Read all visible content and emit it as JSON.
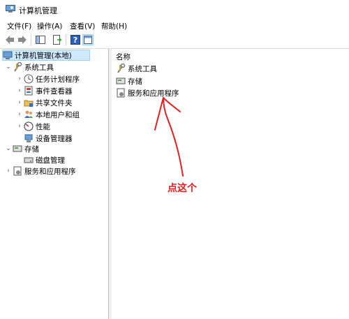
{
  "window": {
    "title": "计算机管理"
  },
  "menu": {
    "file": "文件(F)",
    "action": "操作(A)",
    "view": "查看(V)",
    "help": "帮助(H)"
  },
  "tree": {
    "root": "计算机管理(本地)",
    "system_tools": "系统工具",
    "task_scheduler": "任务计划程序",
    "event_viewer": "事件查看器",
    "shared_folders": "共享文件夹",
    "local_users": "本地用户和组",
    "performance": "性能",
    "device_manager": "设备管理器",
    "storage": "存储",
    "disk_management": "磁盘管理",
    "services_apps": "服务和应用程序"
  },
  "list": {
    "column_name": "名称",
    "items": [
      "系统工具",
      "存储",
      "服务和应用程序"
    ]
  },
  "annotation": {
    "text": "点这个",
    "color": "#e02020"
  }
}
